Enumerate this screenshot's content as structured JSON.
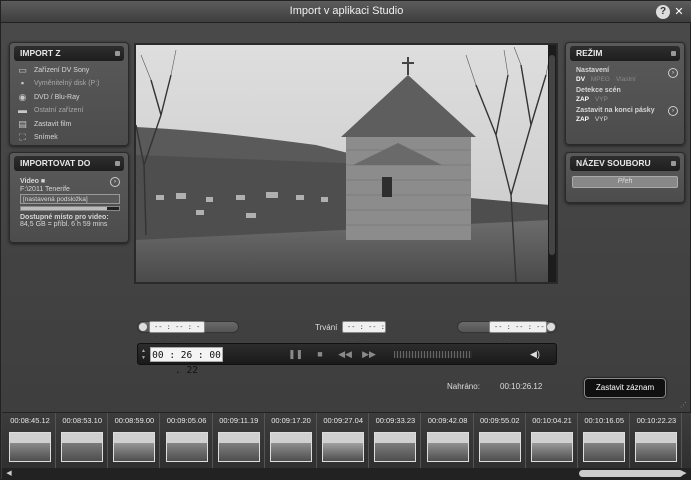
{
  "window": {
    "title": "Import v aplikaci Studio",
    "help_label": "?",
    "close_label": "✕"
  },
  "import_from": {
    "heading": "IMPORT Z",
    "sources": [
      {
        "label": "Zařízení DV Sony",
        "icon": "dv-camera-icon"
      },
      {
        "label": "Vyměnitelný disk (P:)",
        "icon": "removable-disk-icon"
      },
      {
        "label": "DVD / Blu-Ray",
        "icon": "disc-icon"
      },
      {
        "label": "Ostatní zařízení",
        "icon": "folder-icon"
      },
      {
        "label": "Zastavit film",
        "icon": "stop-motion-icon"
      },
      {
        "label": "Snímek",
        "icon": "snapshot-icon"
      }
    ]
  },
  "import_to": {
    "heading": "IMPORTOVAT DO",
    "video_label": "Video",
    "path": "F:\\2011 Tenerife",
    "subfolder": "[nastavená podsložka]",
    "space_label": "Dostupné místo pro video:",
    "space_value": "84,5 GB = příbl. 6 h 59 mins",
    "disk_fill": 0.88
  },
  "mode": {
    "heading": "REŽIM",
    "settings_label": "Nastavení",
    "formats": [
      "DV",
      "MPEG",
      "Vlastní"
    ],
    "scene_detect_label": "Detekce scén",
    "scene_detect_options": [
      "ZAP",
      "VYP"
    ],
    "stop_at_end_label": "Zastavit na konci pásky",
    "stop_at_end_options": [
      "ZAP",
      "VYP"
    ]
  },
  "filename": {
    "heading": "NÁZEV SOUBORU",
    "placeholder": "Přeh"
  },
  "trim": {
    "mark_in": "-- : -- : -- . --",
    "duration_label": "Trvání",
    "duration": "-- : -- : -- . --",
    "mark_out": "-- : -- : -- . --"
  },
  "transport": {
    "timecode": "00 : 26 : 00 . 22"
  },
  "recorded": {
    "label": "Nahráno:",
    "value": "00:10:26.12"
  },
  "record_button": "Zastavit záznam",
  "thumbnails": [
    "00:08:45.12",
    "00:08:53.10",
    "00:08:59.00",
    "00:09:05.06",
    "00:09:11.19",
    "00:09:17.20",
    "00:09:27.04",
    "00:09:33.23",
    "00:09:42.08",
    "00:09:55.02",
    "00:10:04.21",
    "00:10:16.05",
    "00:10:22.23"
  ]
}
